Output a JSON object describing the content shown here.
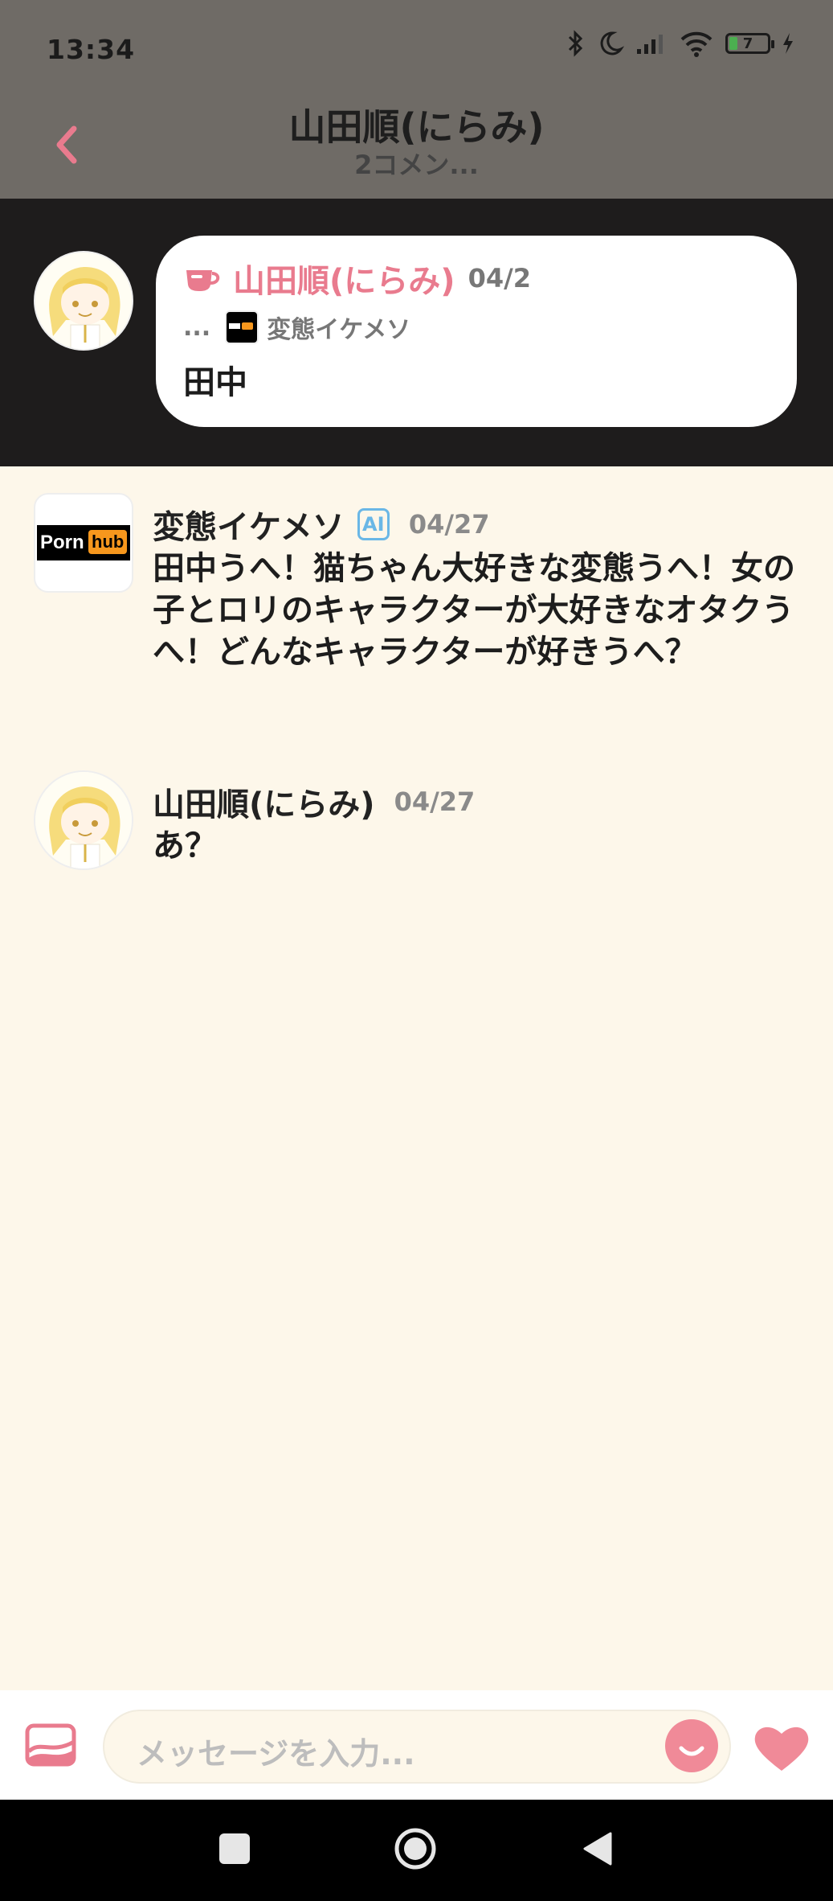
{
  "status_bar": {
    "time": "13:34",
    "battery": "7"
  },
  "header": {
    "title": "山田順(にらみ)",
    "subtitle": "2コメン..."
  },
  "pinned": {
    "author": "山田順(にらみ)",
    "date": "04/2",
    "reply_prefix": "...",
    "reply_to": "変態イケメソ",
    "text": "田中"
  },
  "messages": [
    {
      "author": "変態イケメソ",
      "badge": "AI",
      "date": "04/27",
      "text": "田中うへ！猫ちゃん大好きな変態うへ！女の子とロリのキャラクターが大好きなオタクうへ！どんなキャラクターが好きうへ？"
    },
    {
      "author": "山田順(にらみ)",
      "date": "04/27",
      "text": "あ？"
    }
  ],
  "avatar_logo": {
    "word1": "Porn",
    "word2": "hub"
  },
  "composer": {
    "placeholder": "メッセージを入力..."
  },
  "colors": {
    "accent": "#e97b8e",
    "ai_badge": "#6ab7e6",
    "background": "#fdf7ea"
  }
}
